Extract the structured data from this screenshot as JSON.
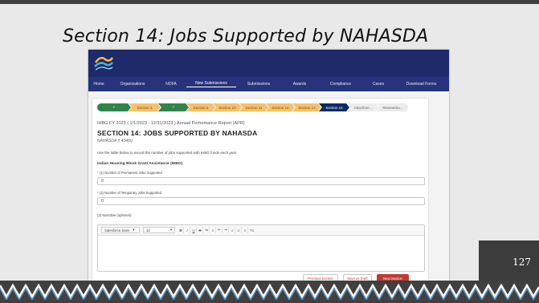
{
  "slide": {
    "title": "Section 14:  Jobs Supported by NAHASDA",
    "number": "127"
  },
  "nav": {
    "items": [
      "Home",
      "Organizations",
      "NOFA",
      "New Submissions",
      "Submissions",
      "Awards",
      "Compliance",
      "Cases",
      "Download Forms"
    ],
    "active": "New Submissions"
  },
  "progress_steps": [
    {
      "label": "✓",
      "state": "done"
    },
    {
      "label": "Section 3",
      "state": "warn"
    },
    {
      "label": "✓",
      "state": "done"
    },
    {
      "label": "Section 6",
      "state": "warn"
    },
    {
      "label": "Section 10",
      "state": "warn"
    },
    {
      "label": "Section 11",
      "state": "warn"
    },
    {
      "label": "Section 12",
      "state": "warn"
    },
    {
      "label": "Section 13",
      "state": "warn"
    },
    {
      "label": "Section 14",
      "state": "current"
    },
    {
      "label": "Attachme...",
      "state": "todo"
    },
    {
      "label": "Review/Su...",
      "state": "todo"
    }
  ],
  "form": {
    "report_line": "IHBG FY 2023 ( 1/1/2023 - 12/31/2023 ) Annual Performance Report (APR)",
    "section_title": "SECTION 14: JOBS SUPPORTED BY NAHASDA",
    "citation": "NAHASDA § 404(b)",
    "instructions": "Use the table below to record the number of jobs supported with IHBG funds each year.",
    "subheading": "Indian Housing Block Grant Assistance (IHBG)",
    "field1_label": "(1) Number of Permanent Jobs Supported",
    "field1_value": "0",
    "field2_label": "(2) Number of Temporary Jobs Supported",
    "field2_value": "0",
    "narrative_label": "(3) Narrative (optional):",
    "required_marker": "*"
  },
  "editor_toolbar": {
    "font": "Salesforce Sans",
    "size": "12",
    "buttons": [
      "B",
      "I",
      "U",
      "S",
      "≔",
      "≡",
      "⇤",
      "⇥",
      "≡",
      "≡",
      "≡",
      "Tx"
    ]
  },
  "buttons": {
    "previous": "Previous Section",
    "draft": "Save as Draft",
    "next": "Next Section"
  },
  "colors": {
    "header": "#1f2a6b",
    "done": "#2e844a",
    "warn": "#f5c26b",
    "current": "#0b2b66",
    "accent": "#c23934"
  }
}
